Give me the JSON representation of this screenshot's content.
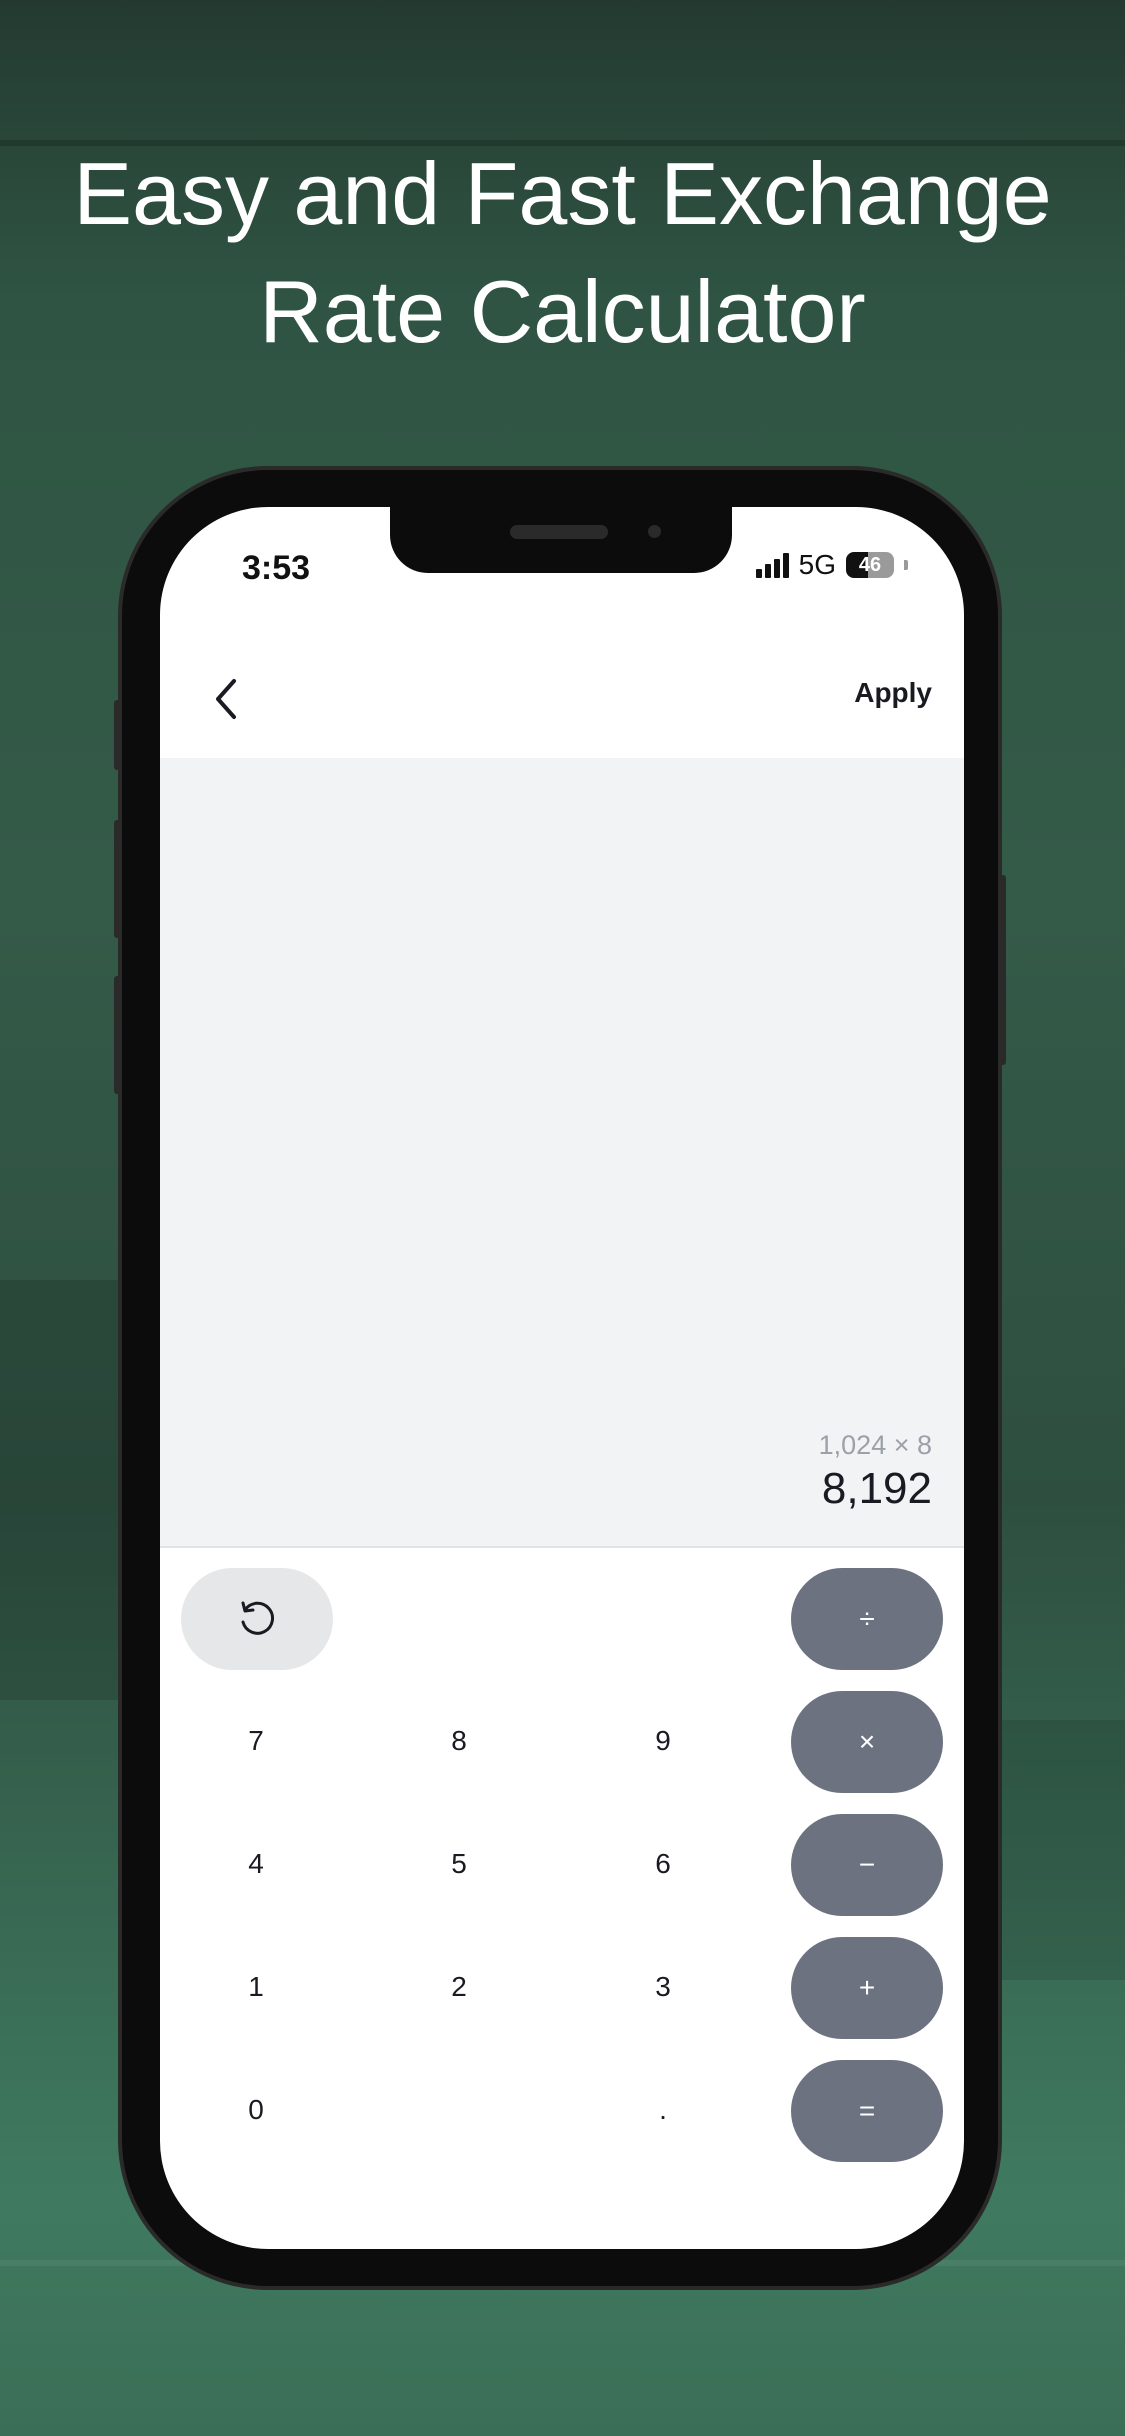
{
  "headline": {
    "line1": "Easy and Fast Exchange",
    "line2": "Rate Calculator"
  },
  "status_bar": {
    "time": "3:53",
    "network": "5G",
    "battery": "46"
  },
  "nav": {
    "back_icon": "chevron-left-icon",
    "apply_label": "Apply"
  },
  "display": {
    "expression": "1,024 × 8",
    "result": "8,192"
  },
  "keypad": {
    "reset_icon": "rotate-ccw-icon",
    "digits": [
      "7",
      "8",
      "9",
      "4",
      "5",
      "6",
      "1",
      "2",
      "3",
      "0",
      "."
    ],
    "operators": {
      "divide": "÷",
      "multiply": "×",
      "subtract": "−",
      "add": "+",
      "equals": "="
    }
  },
  "colors": {
    "background": "#2f5443",
    "operator_key": "#6c7280",
    "reset_key": "#e6e7e8",
    "display_bg": "#f2f3f5"
  }
}
